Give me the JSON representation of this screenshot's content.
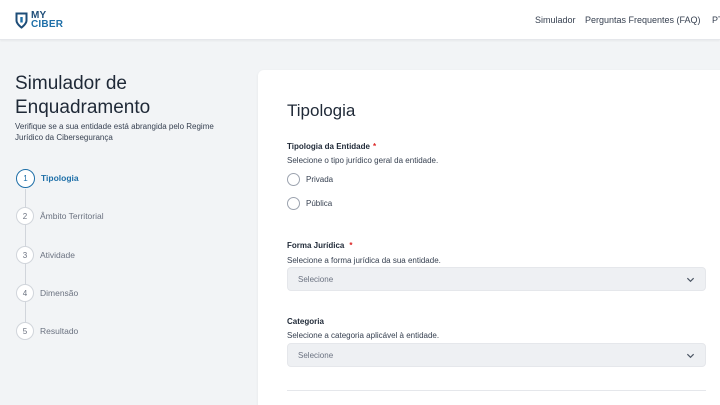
{
  "header": {
    "logo": {
      "line1": "MY",
      "line2": "CIBER",
      "icon": "shield-logo-icon"
    },
    "nav": [
      {
        "label": "Simulador"
      },
      {
        "label": "Perguntas Frequentes (FAQ)"
      },
      {
        "label": "PT"
      }
    ]
  },
  "sidebar": {
    "title": "Simulador de Enquadramento",
    "subtitle": "Verifique se a sua entidade está abrangida pelo Regime Jurídico da Cibersegurança",
    "steps": [
      {
        "number": "1",
        "label": "Tipologia",
        "active": true
      },
      {
        "number": "2",
        "label": "Âmbito Territorial",
        "active": false
      },
      {
        "number": "3",
        "label": "Atividade",
        "active": false
      },
      {
        "number": "4",
        "label": "Dimensão",
        "active": false
      },
      {
        "number": "5",
        "label": "Resultado",
        "active": false
      }
    ]
  },
  "main": {
    "title": "Tipologia",
    "tipologia": {
      "label": "Tipologia da Entidade",
      "required": "*",
      "help": "Selecione o tipo jurídico geral da entidade.",
      "options": [
        "Privada",
        "Pública"
      ]
    },
    "forma": {
      "label": "Forma Jurídica",
      "required": "*",
      "help": "Selecione a forma jurídica da sua entidade.",
      "placeholder": "Selecione"
    },
    "categoria": {
      "label": "Categoria",
      "help": "Selecione a categoria aplicável à entidade.",
      "placeholder": "Selecione"
    }
  },
  "colors": {
    "accent": "#1e6fa8",
    "brand_dark": "#1e4d78",
    "required": "#dc2626"
  }
}
